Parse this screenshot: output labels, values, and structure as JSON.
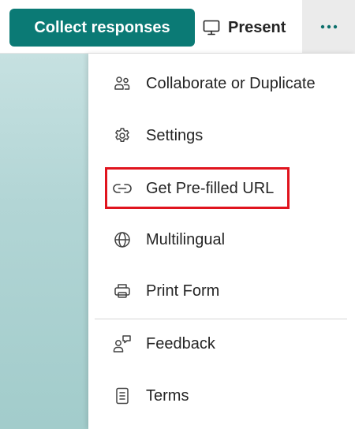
{
  "header": {
    "collect_label": "Collect responses",
    "present_label": "Present",
    "more_icon": "ellipsis-icon",
    "accent_color": "#0b7a75"
  },
  "menu": {
    "items": [
      {
        "label": "Collaborate or Duplicate",
        "icon": "people-icon"
      },
      {
        "label": "Settings",
        "icon": "gear-icon"
      },
      {
        "label": "Get Pre-filled URL",
        "icon": "link-icon",
        "highlighted": true
      },
      {
        "label": "Multilingual",
        "icon": "globe-icon"
      },
      {
        "label": "Print Form",
        "icon": "printer-icon"
      },
      {
        "label": "Feedback",
        "icon": "feedback-icon"
      },
      {
        "label": "Terms",
        "icon": "document-icon"
      }
    ],
    "highlight_color": "#e0141e"
  }
}
